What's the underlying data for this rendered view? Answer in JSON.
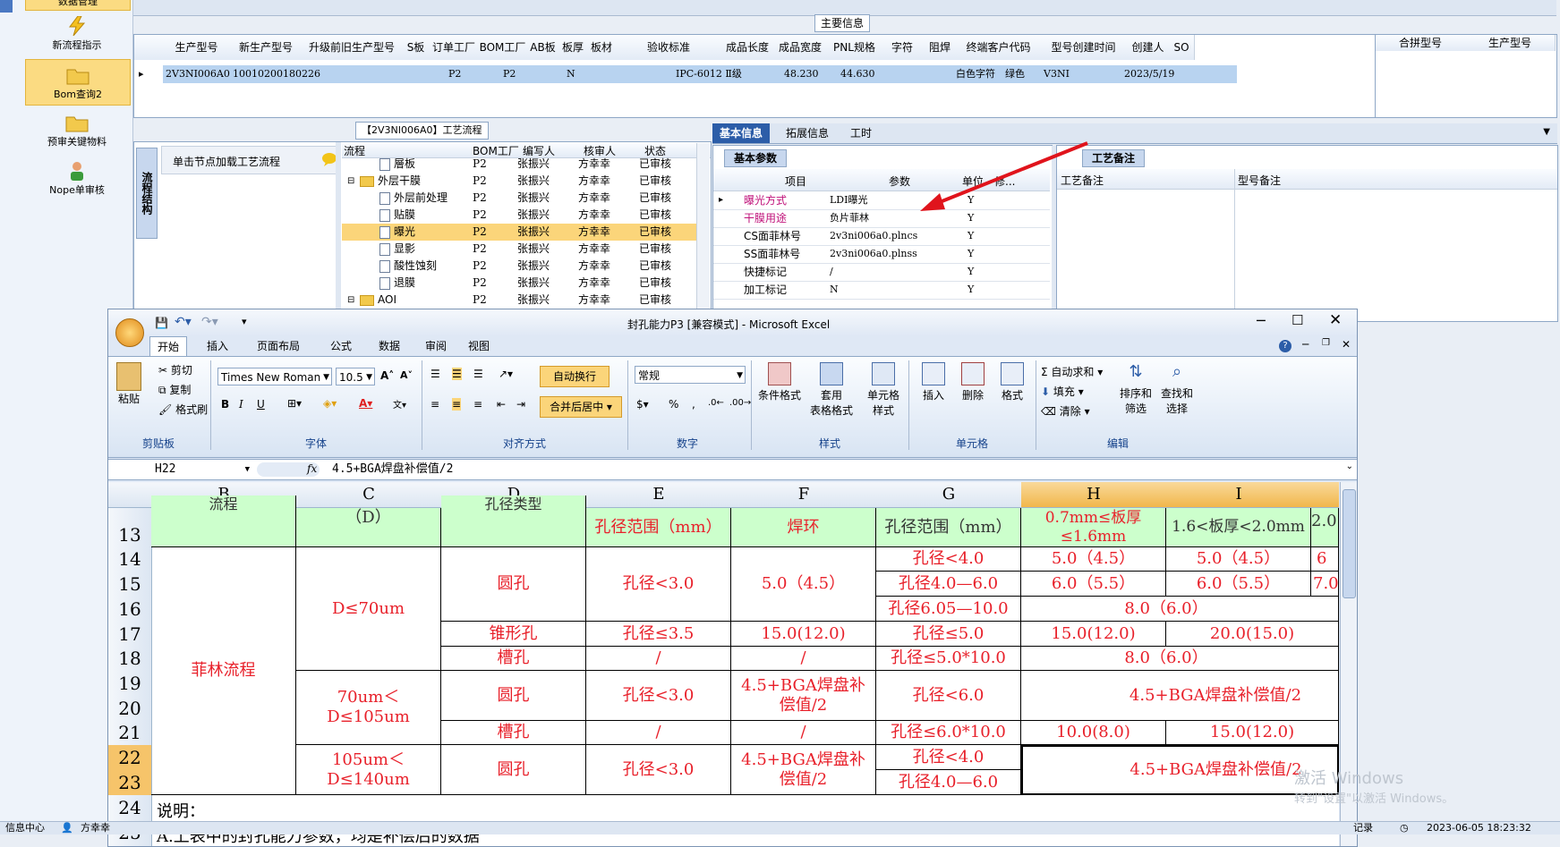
{
  "left_nav": {
    "top_item": "数据管理",
    "items": [
      {
        "label": "新流程指示",
        "icon": "lightning-icon",
        "selected": false
      },
      {
        "label": "Bom查询2",
        "icon": "folder-icon",
        "selected": true
      },
      {
        "label": "预审关键物料",
        "icon": "folder-icon",
        "selected": false
      },
      {
        "label": "Nope单审核",
        "icon": "person-icon",
        "selected": false
      }
    ]
  },
  "main_info": {
    "title": "主要信息",
    "columns": [
      "生产型号",
      "新生产型号",
      "升级前旧生产型号",
      "S板",
      "订单工厂",
      "BOM工厂",
      "AB板",
      "板厚",
      "板材",
      "验收标准",
      "成品长度",
      "成品宽度",
      "PNL规格",
      "字符",
      "阻焊",
      "终端客户代码",
      "型号创建时间",
      "创建人",
      "SO"
    ],
    "row": [
      "2V3NI006A0",
      "10010200180226",
      "",
      "",
      "P2",
      "P2",
      "N",
      "",
      "",
      "IPC-6012 Ⅱ级",
      "48.230",
      "44.630",
      "",
      "白色字符",
      "绿色",
      "V3NI",
      "2023/5/19",
      "",
      ""
    ],
    "side_columns": [
      "合拼型号",
      "生产型号"
    ]
  },
  "process_panel": {
    "title": "【2V3NI006A0】工艺流程",
    "side_tab": "流程结构",
    "load_hint": "单击节点加载工艺流程",
    "columns": [
      "流程",
      "BOM工厂",
      "编写人",
      "核审人",
      "状态"
    ],
    "rows": [
      {
        "name": "層板",
        "level": 2,
        "type": "doc",
        "factory": "P2",
        "writer": "张振兴",
        "reviewer": "方幸幸",
        "status": "已审核",
        "selected": false
      },
      {
        "name": "外层干膜",
        "level": 1,
        "type": "folder",
        "factory": "P2",
        "writer": "张振兴",
        "reviewer": "方幸幸",
        "status": "已审核",
        "selected": false
      },
      {
        "name": "外层前处理",
        "level": 2,
        "type": "doc",
        "factory": "P2",
        "writer": "张振兴",
        "reviewer": "方幸幸",
        "status": "已审核",
        "selected": false
      },
      {
        "name": "贴膜",
        "level": 2,
        "type": "doc",
        "factory": "P2",
        "writer": "张振兴",
        "reviewer": "方幸幸",
        "status": "已审核",
        "selected": false
      },
      {
        "name": "曝光",
        "level": 2,
        "type": "doc",
        "factory": "P2",
        "writer": "张振兴",
        "reviewer": "方幸幸",
        "status": "已审核",
        "selected": true
      },
      {
        "name": "显影",
        "level": 2,
        "type": "doc",
        "factory": "P2",
        "writer": "张振兴",
        "reviewer": "方幸幸",
        "status": "已审核",
        "selected": false
      },
      {
        "name": "酸性蚀刻",
        "level": 2,
        "type": "doc",
        "factory": "P2",
        "writer": "张振兴",
        "reviewer": "方幸幸",
        "status": "已审核",
        "selected": false
      },
      {
        "name": "退膜",
        "level": 2,
        "type": "doc",
        "factory": "P2",
        "writer": "张振兴",
        "reviewer": "方幸幸",
        "status": "已审核",
        "selected": false
      },
      {
        "name": "AOI",
        "level": 1,
        "type": "folder",
        "factory": "P2",
        "writer": "张振兴",
        "reviewer": "方幸幸",
        "status": "已审核",
        "selected": false
      }
    ]
  },
  "detail_tabs": [
    "基本信息",
    "拓展信息",
    "工时"
  ],
  "basic_params": {
    "tab": "基本参数",
    "columns": [
      "项目",
      "参数",
      "单位",
      "修..."
    ],
    "rows": [
      {
        "item": "曝光方式",
        "value": "LDI曝光",
        "flag": "Y"
      },
      {
        "item": "干膜用途",
        "value": "负片菲林",
        "flag": "Y"
      },
      {
        "item": "CS面菲林号",
        "value": "2v3ni006a0.plncs",
        "flag": "Y"
      },
      {
        "item": "SS面菲林号",
        "value": "2v3ni006a0.plnss",
        "flag": "Y"
      },
      {
        "item": "快捷标记",
        "value": "/",
        "flag": "Y"
      },
      {
        "item": "加工标记",
        "value": "N",
        "flag": "Y"
      }
    ]
  },
  "process_notes": {
    "tab": "工艺备注",
    "columns": [
      "工艺备注",
      "型号备注"
    ]
  },
  "excel": {
    "title": "封孔能力P3  [兼容模式] - Microsoft Excel",
    "tabs": [
      "开始",
      "插入",
      "页面布局",
      "公式",
      "数据",
      "审阅",
      "视图"
    ],
    "clipboard": {
      "paste": "粘贴",
      "cut": "剪切",
      "copy": "复制",
      "format_painter": "格式刷",
      "group": "剪贴板"
    },
    "font": {
      "name": "Times New Roman",
      "size": "10.5",
      "group": "字体"
    },
    "align": {
      "wrap": "自动换行",
      "merge": "合并后居中",
      "group": "对齐方式"
    },
    "number": {
      "format": "常规",
      "group": "数字"
    },
    "styles": {
      "cond": "条件格式",
      "table": "套用\n表格格式",
      "cell": "单元格\n样式",
      "group": "样式"
    },
    "cells": {
      "insert": "插入",
      "delete": "删除",
      "format": "格式",
      "group": "单元格"
    },
    "edit": {
      "autosum": "自动求和",
      "fill": "填充",
      "clear": "清除",
      "sort": "排序和\n筛选",
      "find": "查找和\n选择",
      "group": "编辑"
    },
    "name_box": "H22",
    "formula": "4.5+BGA焊盘补偿值/2",
    "columns": [
      "B",
      "C",
      "D",
      "E",
      "F",
      "G",
      "H",
      "I"
    ],
    "row_numbers": [
      "13",
      "14",
      "15",
      "16",
      "17",
      "18",
      "19",
      "20",
      "21",
      "22",
      "23",
      "24",
      "25"
    ],
    "cells_text": {
      "r12_b": "流程",
      "r12_c": "（D）",
      "r12_d": "孔径类型",
      "r13_e": "孔径范围（mm）",
      "r13_f": "焊环",
      "r13_g": "孔径范围（mm）",
      "r13_h": "0.7mm≤板厚≤1.6mm",
      "r13_i": "1.6<板厚<2.0mm",
      "r13_j": "2.0",
      "b_flow": "菲林流程",
      "c_d1": "D≤70um",
      "c_d2": "70um＜D≤105um",
      "c_d3": "105um＜D≤140um",
      "round_hole": "圆孔",
      "cone_hole": "锥形孔",
      "slot_hole": "槽孔",
      "e_lt3": "孔径<3.0",
      "e_le35": "孔径≤3.5",
      "slash": "/",
      "f_50": "5.0（4.5）",
      "f_150": "15.0(12.0)",
      "f_bga": "4.5+BGA焊盘补偿值/2",
      "g14": "孔径<4.0",
      "g15": "孔径4.0—6.0",
      "g16": "孔径6.05—10.0",
      "g17": "孔径≤5.0",
      "g18": "孔径≤5.0*10.0",
      "g19": "孔径<6.0",
      "g21": "孔径≤6.0*10.0",
      "g22": "孔径<4.0",
      "g23": "孔径4.0—6.0",
      "h14": "5.0（4.5）",
      "i14": "5.0（4.5）",
      "j14": "6",
      "h15": "6.0（5.5）",
      "i15": "6.0（5.5）",
      "j15": "7.0",
      "hi16": "8.0（6.0）",
      "h17": "15.0(12.0)",
      "i17": "20.0(15.0)",
      "hi18": "8.0（6.0）",
      "hi19": "4.5+BGA焊盘补偿值/2",
      "h21": "10.0(8.0)",
      "i21": "15.0(12.0)",
      "hi22": "4.5+BGA焊盘补偿值/2",
      "b24": "说明：",
      "b25": "A.上表中的封孔能力参数，均是补偿后的数据"
    }
  },
  "status_bar": {
    "left1": "信息中心",
    "left2": "方幸幸",
    "right1": "记录",
    "datetime": "2023-06-05 18:23:32"
  },
  "watermark": {
    "line1": "激活 Windows",
    "line2": "转到\"设置\"以激活 Windows。"
  }
}
